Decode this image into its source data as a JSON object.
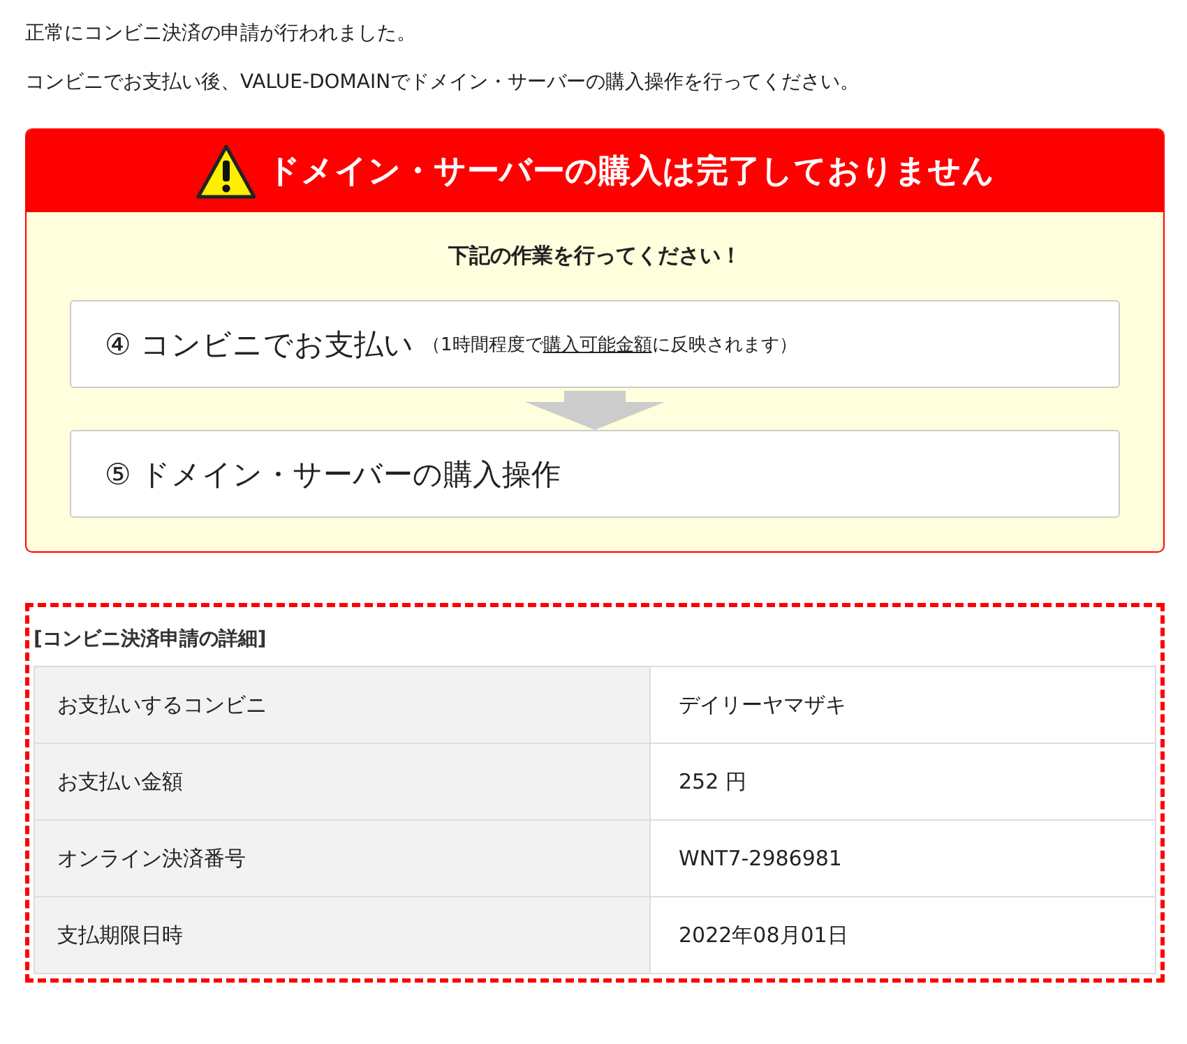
{
  "intro": [
    "正常にコンビニ決済の申請が行われました。",
    "コンビニでお支払い後、VALUE-DOMAINでドメイン・サーバーの購入操作を行ってください。"
  ],
  "alert": {
    "title": "ドメイン・サーバーの購入は完了しておりません",
    "subtitle": "下記の作業を行ってください！",
    "steps": [
      {
        "number": "④",
        "label": "コンビニでお支払い",
        "note_before": "（1時間程度で",
        "note_link": "購入可能金額",
        "note_after": "に反映されます）"
      },
      {
        "number": "⑤",
        "label": "ドメイン・サーバーの購入操作"
      }
    ]
  },
  "details": {
    "caption": "[コンビニ決済申請の詳細]",
    "rows": [
      {
        "label": "お支払いするコンビニ",
        "value": "デイリーヤマザキ"
      },
      {
        "label": "お支払い金額",
        "value": "252 円"
      },
      {
        "label": "オンライン決済番号",
        "value": "WNT7-2986981"
      },
      {
        "label": "支払期限日時",
        "value": "2022年08月01日"
      }
    ]
  }
}
